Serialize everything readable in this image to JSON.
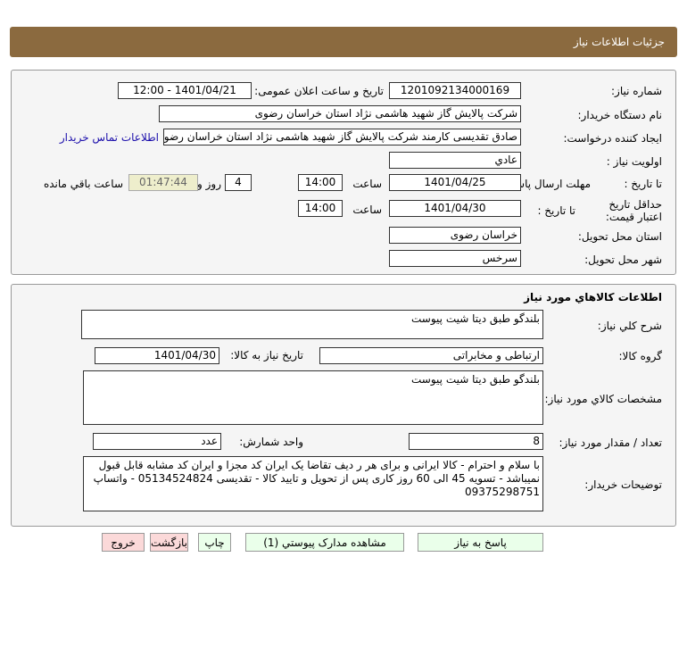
{
  "header": {
    "title": "جزئیات اطلاعات نیاز"
  },
  "info": {
    "need_number_label": "شماره نیاز:",
    "need_number": "1201092134000169",
    "announce_label": "تاریخ و ساعت اعلان عمومی:",
    "announce_value": "1401/04/21 - 12:00",
    "buyer_label": "نام دستگاه خریدار:",
    "buyer": "شرکت پالایش گاز شهید هاشمی نژاد   استان خراسان رضوی",
    "creator_label": "ایجاد کننده درخواست:",
    "creator": "صادق تقدیسی کارمند شرکت پالایش گاز شهید هاشمی نژاد   استان خراسان رضوی",
    "contact_link": "اطلاعات تماس خریدار",
    "priority_label": "اولویت نیاز :",
    "priority": "عادي",
    "deadline_label": "مهلت ارسال پاسخ:",
    "to_date_label": "تا تاریخ :",
    "deadline_date": "1401/04/25",
    "time_label": "ساعت",
    "deadline_time": "14:00",
    "days": "4",
    "days_label": "روز و",
    "remaining": "01:47:44",
    "remaining_label": "ساعت باقي مانده",
    "validity_label": "حداقل تاریخ اعتبار قیمت:",
    "validity_date": "1401/04/30",
    "validity_time": "14:00",
    "province_label": "استان محل تحویل:",
    "province": "خراسان رضوی",
    "city_label": "شهر محل تحویل:",
    "city": "سرخس"
  },
  "goods": {
    "title": "اطلاعات کالاهاي مورد نياز",
    "desc_label": "شرح کلي نياز:",
    "desc": "بلندگو طبق دیتا شیت پیوست",
    "group_label": "گروه کالا:",
    "group": "ارتباطی و مخابراتی",
    "need_date_label": "تاریخ نیاز به کالا:",
    "need_date": "1401/04/30",
    "spec_label": "مشخصات کالاي مورد نياز:",
    "spec": "بلندگو طبق دیتا شیت پیوست",
    "qty_label": "تعداد / مقدار مورد نیاز:",
    "qty": "8",
    "unit_label": "واحد شمارش:",
    "unit": "عدد",
    "notes_label": "توضیحات خریدار:",
    "notes": "با سلام و احترام - کالا ایرانی  و برای هر ر دیف تقاضا یک ایران کد مجزا و ایران کد مشابه قابل قبول نمیباشد - تسویه 45 الی 60 روز کاری پس از تحویل و تایید کالا - تقدیسی 05134524824 - واتساپ 09375298751"
  },
  "buttons": {
    "reply": "پاسخ به نیاز",
    "docs": "مشاهده مدارک پیوستي (1)",
    "print": "چاپ",
    "back": "بازگشت",
    "exit": "خروج"
  }
}
